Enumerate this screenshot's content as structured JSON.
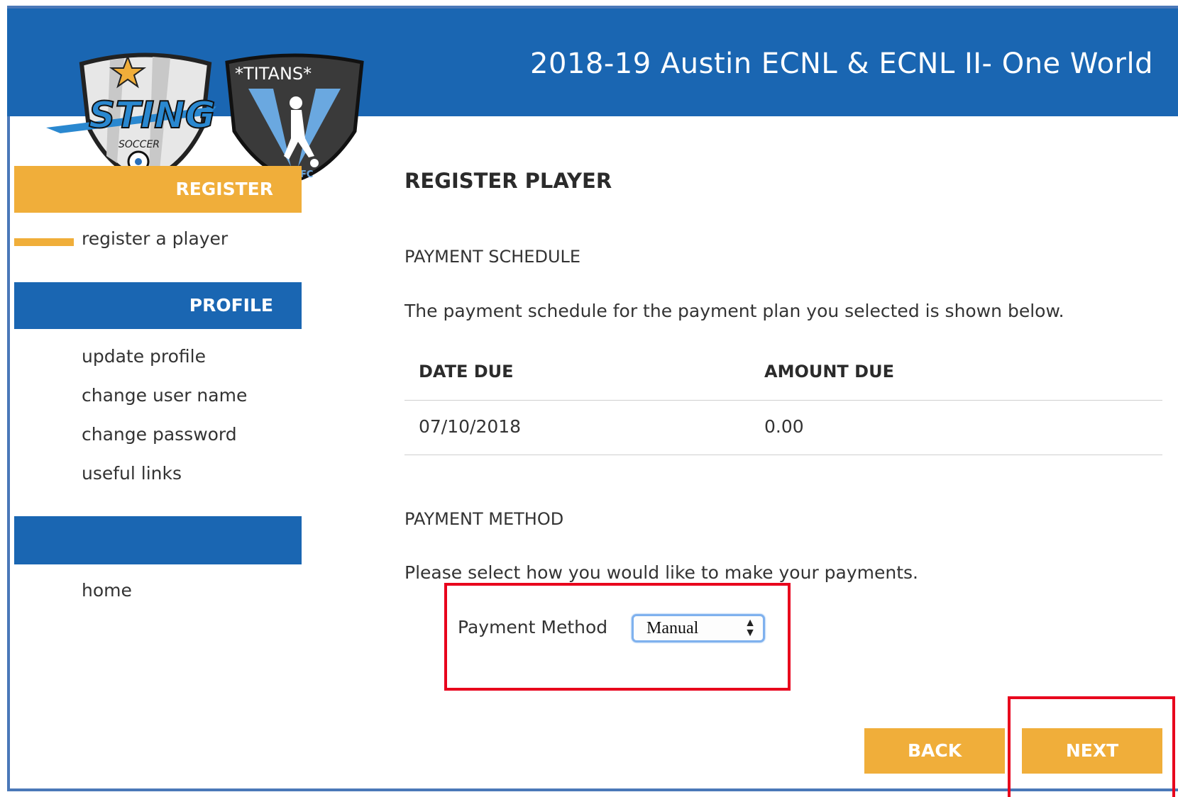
{
  "header": {
    "title": "2018-19 Austin ECNL & ECNL II- One World"
  },
  "logo": {
    "left_text": "STING",
    "left_sub": "SOCCER",
    "right_text": "*TITANS*",
    "right_sub": "FC"
  },
  "sidebar": {
    "register_heading": "REGISTER",
    "register_items": [
      "register a player"
    ],
    "profile_heading": "PROFILE",
    "profile_items": [
      "update profile",
      "change user name",
      "change password",
      "useful links"
    ],
    "other_items": [
      "home"
    ]
  },
  "main": {
    "title": "REGISTER PLAYER",
    "schedule_heading": "PAYMENT SCHEDULE",
    "schedule_text": "The payment schedule for the payment plan you selected is shown below.",
    "schedule_table": {
      "columns": [
        "DATE DUE",
        "AMOUNT DUE"
      ],
      "rows": [
        [
          "07/10/2018",
          "0.00"
        ]
      ]
    },
    "method_heading": "PAYMENT METHOD",
    "method_text": "Please select how you would like to make your payments.",
    "method_label": "Payment Method",
    "method_selected": "Manual"
  },
  "buttons": {
    "back": "BACK",
    "next": "NEXT"
  },
  "colors": {
    "brand_blue": "#1a66b2",
    "accent_orange": "#f0ae3a",
    "highlight_red": "#e8001c"
  }
}
